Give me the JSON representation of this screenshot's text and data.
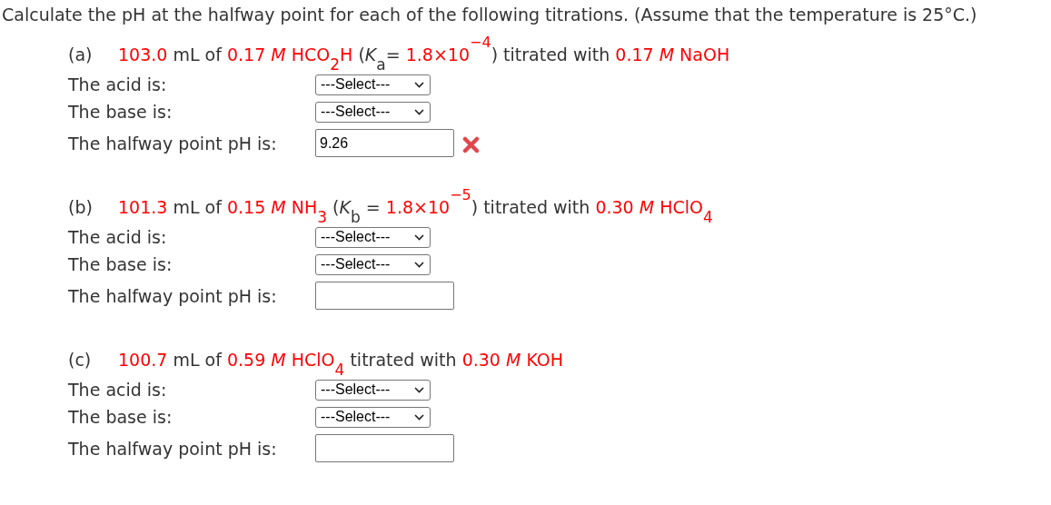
{
  "instructions": "Calculate the pH at the halfway point for each of the following titrations. (Assume that the temperature is 25°C.)",
  "problems": [
    {
      "label": "(a)",
      "statement": [
        {
          "text": "103.0",
          "color": "#ff0000"
        },
        {
          "text": " mL of ",
          "color": "#333333"
        },
        {
          "text": "0.17 *M* HCO$_{2}$H",
          "color": "#ff0000"
        },
        {
          "text": " (*K*$_{a}$= ",
          "color": "#333333"
        },
        {
          "text": "1.8×10$^{−4}$",
          "color": "#ff0000"
        },
        {
          "text": ") titrated with ",
          "color": "#333333"
        },
        {
          "text": "0.17 *M* NaOH",
          "color": "#ff0000"
        }
      ],
      "rows": [
        {
          "kind": "select",
          "label": "The acid is:",
          "value": "---Select---"
        },
        {
          "kind": "select",
          "label": "The base is:",
          "value": "---Select---"
        },
        {
          "kind": "input",
          "label": "The halfway point pH is:",
          "value": "9.26",
          "incorrect": true
        }
      ]
    },
    {
      "label": "(b)",
      "statement": [
        {
          "text": "101.3",
          "color": "#ff0000"
        },
        {
          "text": " mL of ",
          "color": "#333333"
        },
        {
          "text": "0.15 *M* NH$_{3}$",
          "color": "#ff0000"
        },
        {
          "text": " (*K*$_{b}$ = ",
          "color": "#333333"
        },
        {
          "text": "1.8×10$^{−5}$",
          "color": "#ff0000"
        },
        {
          "text": ") titrated with ",
          "color": "#333333"
        },
        {
          "text": "0.30 *M* HClO$_{4}$",
          "color": "#ff0000"
        }
      ],
      "rows": [
        {
          "kind": "select",
          "label": "The acid is:",
          "value": "---Select---"
        },
        {
          "kind": "select",
          "label": "The base is:",
          "value": "---Select---"
        },
        {
          "kind": "input",
          "label": "The halfway point pH is:",
          "incorrect": false
        }
      ]
    },
    {
      "label": "(c)",
      "statement": [
        {
          "text": "100.7",
          "color": "#ff0000"
        },
        {
          "text": " mL of ",
          "color": "#333333"
        },
        {
          "text": "0.59 *M* HClO$_{4}$",
          "color": "#ff0000"
        },
        {
          "text": " titrated with ",
          "color": "#333333"
        },
        {
          "text": "0.30 *M* KOH",
          "color": "#ff0000"
        }
      ],
      "rows": [
        {
          "kind": "select",
          "label": "The acid is:",
          "value": "---Select---"
        },
        {
          "kind": "select",
          "label": "The base is:",
          "value": "---Select---"
        },
        {
          "kind": "input",
          "label": "The halfway point pH is:",
          "incorrect": false
        }
      ]
    }
  ]
}
